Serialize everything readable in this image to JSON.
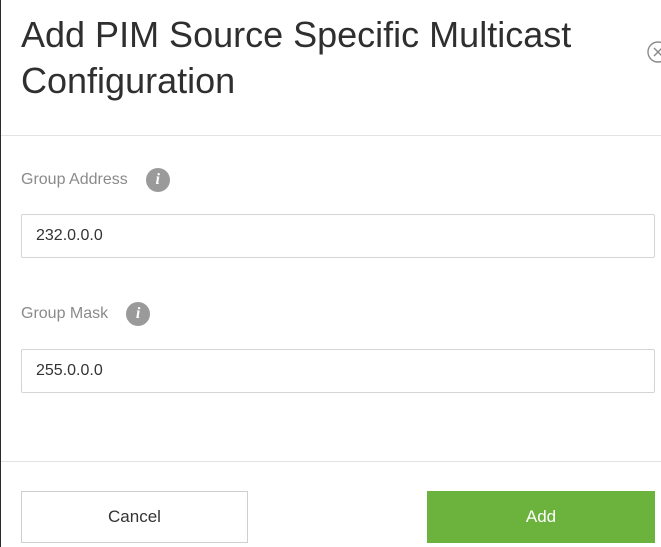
{
  "dialog": {
    "title": "Add PIM Source Specific Multicast Configuration",
    "close_icon": "close-circle-icon"
  },
  "fields": {
    "group_address": {
      "label": "Group Address",
      "value": "232.0.0.0",
      "info_icon": "info-icon",
      "info_glyph": "i"
    },
    "group_mask": {
      "label": "Group Mask",
      "value": "255.0.0.0",
      "info_icon": "info-icon",
      "info_glyph": "i"
    }
  },
  "footer": {
    "cancel_label": "Cancel",
    "add_label": "Add"
  },
  "colors": {
    "primary_button": "#6cb33e",
    "title_text": "#2f2f2f",
    "label_text": "#8a8a8a",
    "info_icon_bg": "#9a9a9a"
  }
}
